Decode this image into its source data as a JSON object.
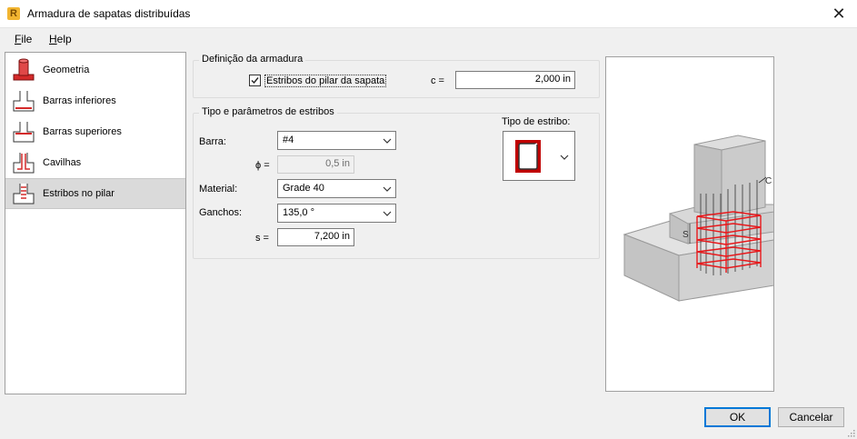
{
  "window": {
    "title": "Armadura de sapatas distribuídas",
    "app_icon_letter": "R"
  },
  "menu": [
    {
      "label": "File",
      "mnemonic": "F",
      "rest": "ile"
    },
    {
      "label": "Help",
      "mnemonic": "H",
      "rest": "elp"
    }
  ],
  "nav": {
    "items": [
      {
        "label": "Geometria",
        "icon": "column-footing-geometry-icon"
      },
      {
        "label": "Barras inferiores",
        "icon": "bottom-bars-icon"
      },
      {
        "label": "Barras superiores",
        "icon": "top-bars-icon"
      },
      {
        "label": "Cavilhas",
        "icon": "dowels-icon"
      },
      {
        "label": "Estribos no pilar",
        "icon": "column-stirrups-icon",
        "selected": true
      }
    ]
  },
  "definition": {
    "title": "Definição da armadura",
    "checkbox_label": "Estribos do pilar da sapata",
    "checked": true,
    "c_label": "c =",
    "c_value": "2,000 in"
  },
  "params": {
    "title": "Tipo e parâmetros de estribos",
    "barra_label": "Barra:",
    "barra_value": "#4",
    "phi_label": "ϕ =",
    "phi_value": "0,5 in",
    "material_label": "Material:",
    "material_value": "Grade 40",
    "ganchos_label": "Ganchos:",
    "ganchos_value": "135,0 °",
    "s_label": "s =",
    "s_value": "7,200 in",
    "tipo_label": "Tipo de estribo:"
  },
  "preview": {
    "c_label": "C",
    "s_label": "S"
  },
  "buttons": {
    "ok": "OK",
    "cancel": "Cancelar"
  },
  "colors": {
    "rebar": "#e8181b",
    "concrete": "#c8c8c8",
    "accent": "#0078d7"
  }
}
